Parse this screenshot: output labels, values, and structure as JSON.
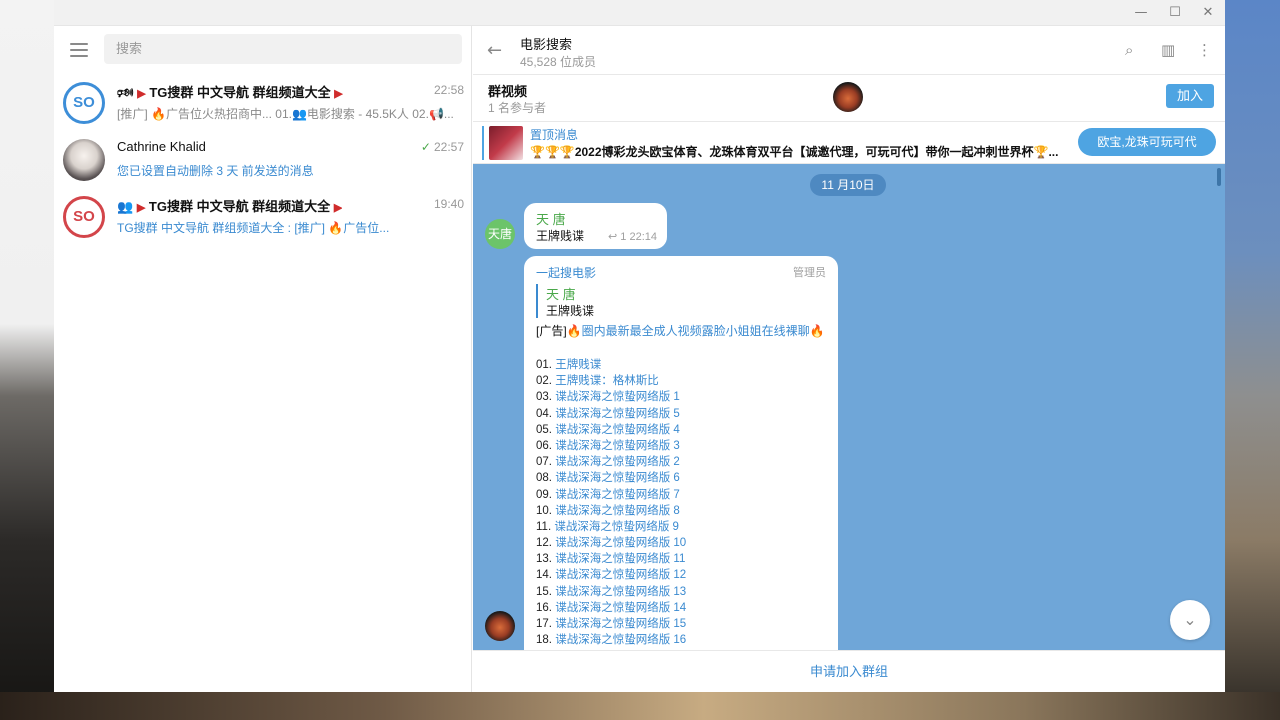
{
  "window": {
    "controls": {
      "minimize": "—",
      "maximize": "☐",
      "close": "✕"
    }
  },
  "left_panel": {
    "search_placeholder": "搜索",
    "chats": [
      {
        "avatar_text": "SO",
        "name_prefix": "🕬",
        "name": "TG搜群 中文导航 群组频道大全",
        "time": "22:58",
        "preview": "[推广] 🔥广告位火热招商中... 01.👥电影搜索 - 45.5K人 02.📢..."
      },
      {
        "name": "Cathrine Khalid",
        "time": "22:57",
        "preview": "您已设置自动删除 3 天 前发送的消息"
      },
      {
        "avatar_text": "SO",
        "name_prefix": "👥",
        "name": "TG搜群 中文导航 群组频道大全",
        "time": "19:40",
        "preview": "TG搜群 中文导航 群组频道大全 : [推广] 🔥广告位..."
      }
    ]
  },
  "chat": {
    "title": "电影搜索",
    "members": "45,528 位成员",
    "video": {
      "title": "群视频",
      "participants": "1 名参与者",
      "join": "加入"
    },
    "pinned": {
      "title": "置顶消息",
      "text": "🏆🏆🏆2022博彩龙头欧宝体育、龙珠体育双平台【诚邀代理，可玩可代】带你一起冲刺世界杯🏆...",
      "button": "欧宝,龙珠可玩可代"
    },
    "date_pill": "11 月10日",
    "messages": [
      {
        "avatar_text": "天唐",
        "sender": "天 唐",
        "text": "王牌贱谍",
        "replies": "↩ 1",
        "time": "22:14"
      },
      {
        "sender": "一起搜电影",
        "role": "管理员",
        "quote_name": "天 唐",
        "quote_text": "王牌贱谍",
        "ad_prefix": "[广告]🔥",
        "ad_link": "圈内最新最全成人视频露脸小姐姐在线裸聊",
        "ad_suffix": "🔥",
        "episodes": [
          {
            "num": "01.",
            "title": "王牌贱谍"
          },
          {
            "num": "02.",
            "title": "王牌贱谍：格林斯比"
          },
          {
            "num": "03.",
            "title": "谍战深海之惊蛰网络版 1"
          },
          {
            "num": "04.",
            "title": "谍战深海之惊蛰网络版 5"
          },
          {
            "num": "05.",
            "title": "谍战深海之惊蛰网络版 4"
          },
          {
            "num": "06.",
            "title": "谍战深海之惊蛰网络版 3"
          },
          {
            "num": "07.",
            "title": "谍战深海之惊蛰网络版 2"
          },
          {
            "num": "08.",
            "title": "谍战深海之惊蛰网络版 6"
          },
          {
            "num": "09.",
            "title": "谍战深海之惊蛰网络版 7"
          },
          {
            "num": "10.",
            "title": "谍战深海之惊蛰网络版 8"
          },
          {
            "num": "11.",
            "title": "谍战深海之惊蛰网络版 9"
          },
          {
            "num": "12.",
            "title": "谍战深海之惊蛰网络版 10"
          },
          {
            "num": "13.",
            "title": "谍战深海之惊蛰网络版 11"
          },
          {
            "num": "14.",
            "title": "谍战深海之惊蛰网络版 12"
          },
          {
            "num": "15.",
            "title": "谍战深海之惊蛰网络版 13"
          },
          {
            "num": "16.",
            "title": "谍战深海之惊蛰网络版 14"
          },
          {
            "num": "17.",
            "title": "谍战深海之惊蛰网络版 15"
          },
          {
            "num": "18.",
            "title": "谍战深海之惊蛰网络版 16"
          }
        ]
      }
    ],
    "bottom_action": "申请加入群组"
  },
  "icons": {
    "back": "←",
    "search": "⌕",
    "sidebar": "▥",
    "more": "⋮",
    "scroll_down": "⌄"
  },
  "colors": {
    "accent": "#3a8ad0",
    "chat_background": "#6fa6d8",
    "button": "#4ea4e2",
    "sender_green": "#4aa84a"
  }
}
